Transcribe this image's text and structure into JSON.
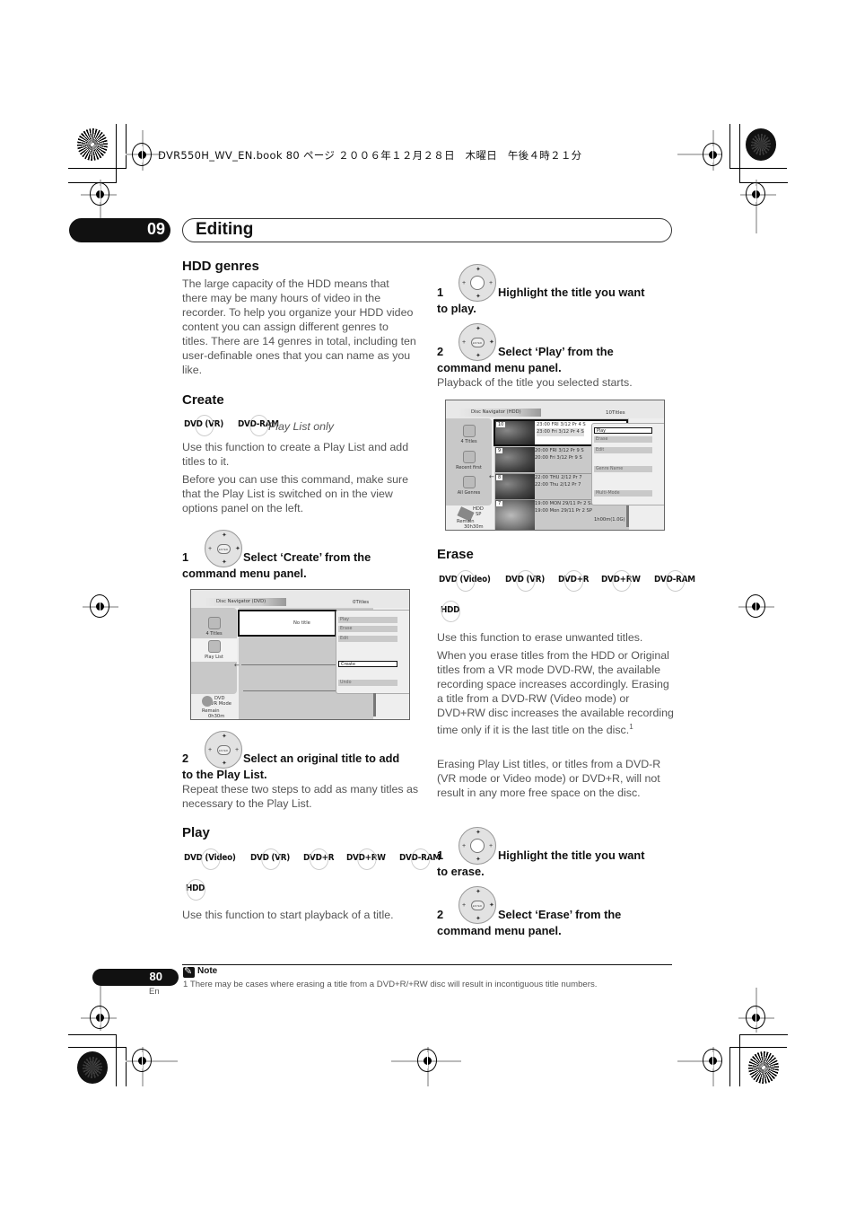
{
  "print_header": "DVR550H_WV_EN.book  80 ページ  ２００６年１２月２８日　木曜日　午後４時２１分",
  "chapter": {
    "number": "09",
    "title": "Editing"
  },
  "left_column": {
    "hdd_genres": {
      "heading": "HDD genres",
      "body": "The large capacity of the HDD means that there may be many hours of video in the recorder. To help you organize your HDD video content you can assign different genres to titles. There are 14 genres in total, including ten user-definable ones that you can name as you like."
    },
    "create": {
      "heading": "Create",
      "badges": [
        "DVD (VR)",
        "DVD-RAM"
      ],
      "badge_note": "Play List only",
      "para1": "Use this function to create a Play List and add titles to it.",
      "para2": "Before you can use this command, make sure that the Play List is switched on in the view options panel on the left.",
      "step1": {
        "num": "1",
        "text_a": "Select ‘Create’ from the",
        "text_b": "command menu panel."
      },
      "screen": {
        "nav_title": "Disc Navigator (DVD)",
        "titles_count": "0Titles",
        "sidebar": [
          "4 Titles",
          "Play List"
        ],
        "disc_type": "DVD",
        "mode": "VR Mode",
        "remain_label": "Remain",
        "remain_value": "0h30m",
        "no_title": "No title",
        "menu": [
          "Play",
          "Erase",
          "Edit",
          "Create",
          "Undo"
        ],
        "selected_menu": "Create"
      },
      "step2": {
        "num": "2",
        "text_a": "Select an original title to add",
        "text_b": "to the Play List."
      },
      "step2_note": "Repeat these two steps to add as many titles as necessary to the Play List."
    },
    "play": {
      "heading": "Play",
      "badges": [
        "DVD (Video)",
        "DVD (VR)",
        "DVD+R",
        "DVD+RW",
        "DVD-RAM"
      ],
      "badges_row2": [
        "HDD"
      ],
      "body": "Use this function to start playback of a title."
    }
  },
  "right_column": {
    "play_steps": {
      "step1": {
        "num": "1",
        "text_a": "Highlight the title you want",
        "text_b": "to play."
      },
      "step2": {
        "num": "2",
        "text_a": "Select ‘Play’ from the",
        "text_b": "command menu panel."
      },
      "step2_note": "Playback of the title you selected starts."
    },
    "screen": {
      "nav_title": "Disc Navigator (HDD)",
      "titles_count": "10Titles",
      "sidebar": [
        "4 Titles",
        "Recent first",
        "All Genres"
      ],
      "drive": "HDD",
      "quality": "SP",
      "remain_label": "Remain",
      "remain_value": "30h30m",
      "rows": [
        {
          "num": "10",
          "line1": "23:00 FRI  3/12  Pr 4  S",
          "line2": "23:00  Fri  3/12  Pr 4  S"
        },
        {
          "num": "9",
          "line1": "20:00  FRI  3/12  Pr 9  S",
          "line2": "20:00   Fri  3/12  Pr 9  S"
        },
        {
          "num": "8",
          "line1": "22:00  THU  2/12  Pr 7",
          "line2": "22:00   Thu  2/12  Pr 7"
        },
        {
          "num": "7",
          "line1": "19:00  MON  29/11  Pr 2  SP",
          "line2": "19:00   Mon  29/11  Pr 2  SP"
        }
      ],
      "duration": "1h00m(1.0G)",
      "menu": [
        "Play",
        "Erase",
        "Edit",
        "Genre Name",
        "Multi-Mode"
      ],
      "selected_menu": "Play"
    },
    "erase": {
      "heading": "Erase",
      "badges": [
        "DVD (Video)",
        "DVD (VR)",
        "DVD+R",
        "DVD+RW",
        "DVD-RAM"
      ],
      "badges_row2": [
        "HDD"
      ],
      "para1": "Use this function to erase unwanted titles.",
      "para2": "When you erase titles from the HDD or Original titles from a VR mode DVD-RW, the available recording space increases accordingly. Erasing a title from a DVD-RW (Video mode) or DVD+RW disc increases the available recording time only if it is the last title on the disc.",
      "para2_footnote": "1",
      "para3": "Erasing Play List titles, or titles from a DVD-R (VR mode or Video mode) or DVD+R, will not result in any more free space on the disc.",
      "step1": {
        "num": "1",
        "text_a": "Highlight the title you want",
        "text_b": "to erase."
      },
      "step2": {
        "num": "2",
        "text_a": "Select ‘Erase’ from the",
        "text_b": "command menu panel."
      }
    }
  },
  "footer": {
    "page_number": "80",
    "language": "En",
    "note_label": "Note",
    "note_text": "1 There may be cases where erasing a title from a DVD+R/+RW disc will result in incontiguous title numbers."
  }
}
